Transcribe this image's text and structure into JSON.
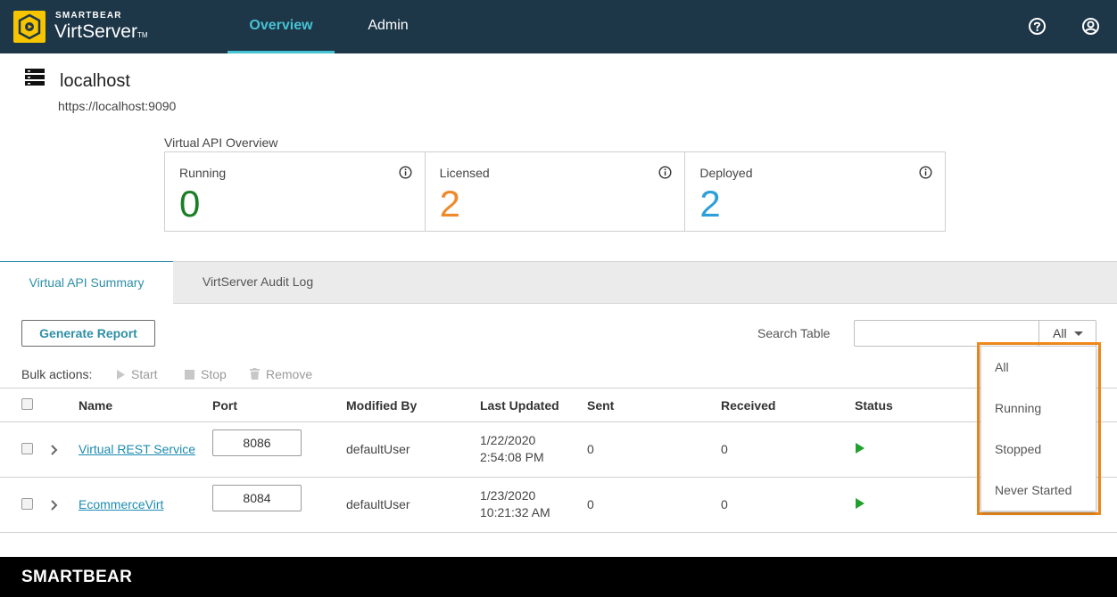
{
  "header": {
    "brand_small": "SMARTBEAR",
    "brand_big": "VirtServer",
    "brand_tm": "TM",
    "logo_icon": "virtserver-logo-icon",
    "nav": [
      {
        "label": "Overview",
        "active": true
      },
      {
        "label": "Admin",
        "active": false
      }
    ],
    "help_icon": "help-circle-icon",
    "user_icon": "user-circle-icon"
  },
  "server": {
    "icon": "server-icon",
    "name": "localhost",
    "url": "https://localhost:9090"
  },
  "overview": {
    "label": "Virtual API Overview",
    "cards": [
      {
        "title": "Running",
        "value": "0",
        "color": "#1a7f24"
      },
      {
        "title": "Licensed",
        "value": "2",
        "color": "#ef8a2b"
      },
      {
        "title": "Deployed",
        "value": "2",
        "color": "#2f9fd8"
      }
    ]
  },
  "subtabs": [
    {
      "label": "Virtual API Summary",
      "active": true
    },
    {
      "label": "VirtServer Audit Log",
      "active": false
    }
  ],
  "toolbar": {
    "generate_report": "Generate Report",
    "search_label": "Search Table",
    "search_value": "",
    "filter_value": "All",
    "bulk_label": "Bulk actions:",
    "bulk_actions": [
      "Start",
      "Stop",
      "Remove"
    ]
  },
  "table": {
    "columns": [
      "Name",
      "Port",
      "Modified By",
      "Last Updated",
      "Sent",
      "Received",
      "Status"
    ],
    "rows": [
      {
        "name": "Virtual REST Service",
        "port": "8086",
        "modified_by": "defaultUser",
        "date": "1/22/2020",
        "time": "2:54:08 PM",
        "sent": "0",
        "received": "0",
        "status": "running"
      },
      {
        "name": "EcommerceVirt",
        "port": "8084",
        "modified_by": "defaultUser",
        "date": "1/23/2020",
        "time": "10:21:32 AM",
        "sent": "0",
        "received": "0",
        "status": "running"
      }
    ]
  },
  "dropdown": {
    "options": [
      "All",
      "Running",
      "Stopped",
      "Never Started"
    ],
    "highlight_color": "#f08a1c"
  },
  "footer": {
    "logo": "SMARTBEAR"
  }
}
